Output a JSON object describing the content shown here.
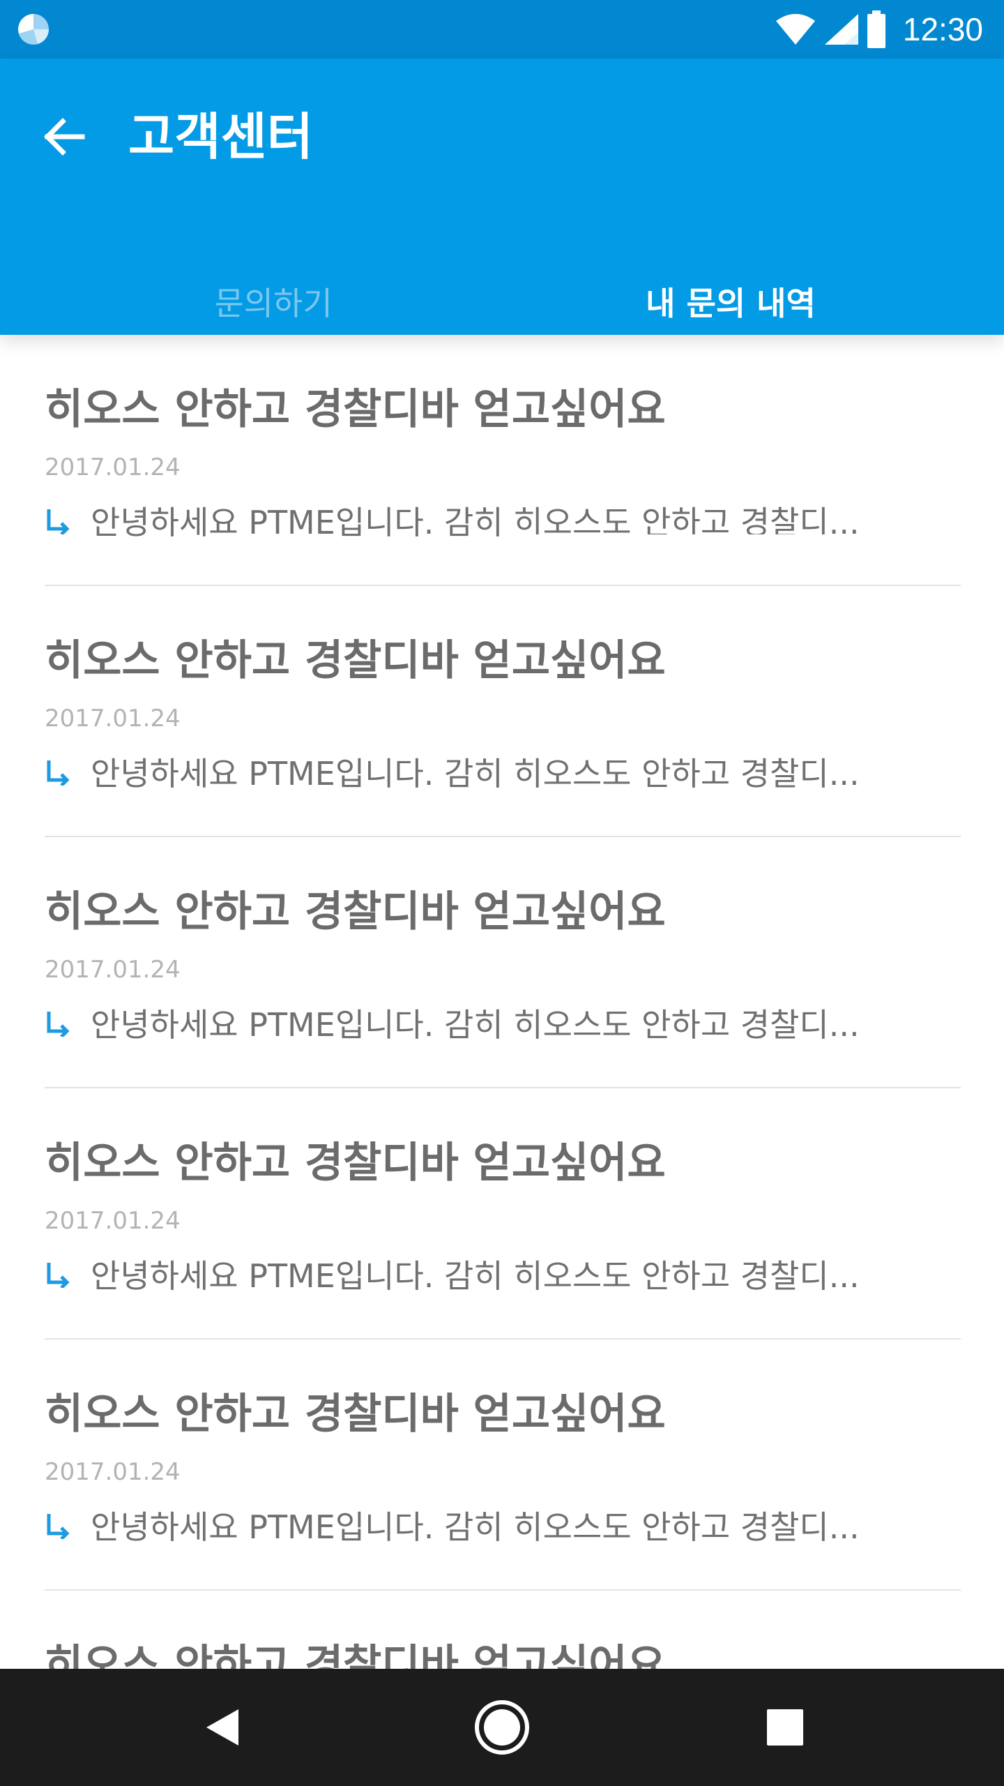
{
  "status_bar": {
    "time": "12:30",
    "icons": [
      "app-pie-icon",
      "wifi-icon",
      "signal-icon",
      "battery-icon"
    ]
  },
  "app_bar": {
    "title": "고객센터",
    "back_icon": "arrow-back-icon",
    "background": "#039be5"
  },
  "tabs": [
    {
      "label": "문의하기",
      "selected": false
    },
    {
      "label": "내 문의 내역",
      "selected": true
    }
  ],
  "inquiries": [
    {
      "title": "히오스 안하고 경찰디바 얻고싶어요",
      "date": "2017.01.24",
      "reply": "안녕하세요 PTME입니다. 감히 히오스도 안하고 경찰디..."
    },
    {
      "title": "히오스 안하고 경찰디바 얻고싶어요",
      "date": "2017.01.24",
      "reply": "안녕하세요 PTME입니다. 감히 히오스도 안하고 경찰디..."
    },
    {
      "title": "히오스 안하고 경찰디바 얻고싶어요",
      "date": "2017.01.24",
      "reply": "안녕하세요 PTME입니다. 감히 히오스도 안하고 경찰디..."
    },
    {
      "title": "히오스 안하고 경찰디바 얻고싶어요",
      "date": "2017.01.24",
      "reply": "안녕하세요 PTME입니다. 감히 히오스도 안하고 경찰디..."
    },
    {
      "title": "히오스 안하고 경찰디바 얻고싶어요",
      "date": "2017.01.24",
      "reply": "안녕하세요 PTME입니다. 감히 히오스도 안하고 경찰디..."
    },
    {
      "title": "히오스 안하고 경찰디바 얻고싶어요",
      "date": "",
      "reply": ""
    }
  ],
  "colors": {
    "status_bar": "#0288d1",
    "accent": "#039be5",
    "reply_icon": "#1e9be0",
    "nav_bar": "#1c1c1c"
  },
  "nav_bar": {
    "buttons": [
      "nav-back-icon",
      "nav-home-icon",
      "nav-recent-icon"
    ]
  }
}
